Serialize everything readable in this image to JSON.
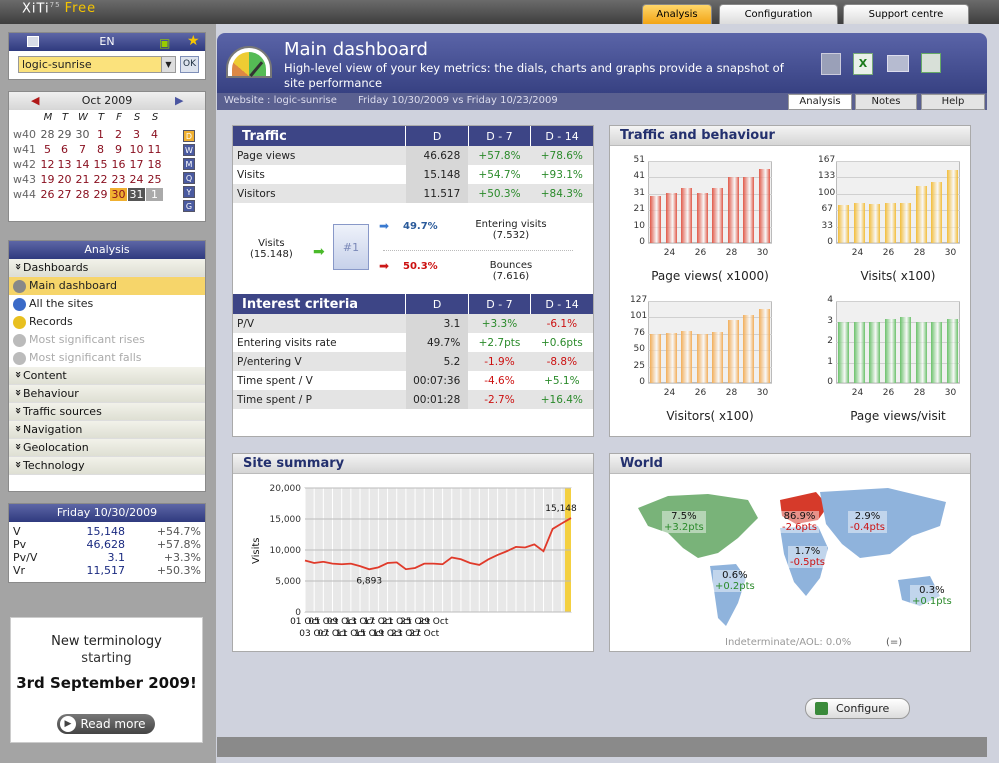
{
  "app": {
    "logo": "XiTi",
    "version": "75",
    "edition": "Free"
  },
  "top_tabs": [
    {
      "label": "Analysis",
      "active": true
    },
    {
      "label": "Configuration",
      "active": false
    },
    {
      "label": "Support centre",
      "active": false
    }
  ],
  "site": {
    "lang": "EN",
    "selected": "logic-sunrise",
    "ok": "OK"
  },
  "calendar": {
    "title": "Oct 2009",
    "weekdays": [
      "M",
      "T",
      "W",
      "T",
      "F",
      "S",
      "S"
    ],
    "weeks": [
      {
        "w": "w40",
        "days": [
          "28",
          "29",
          "30",
          "1",
          "2",
          "3",
          "4"
        ]
      },
      {
        "w": "w41",
        "days": [
          "5",
          "6",
          "7",
          "8",
          "9",
          "10",
          "11"
        ]
      },
      {
        "w": "w42",
        "days": [
          "12",
          "13",
          "14",
          "15",
          "16",
          "17",
          "18"
        ]
      },
      {
        "w": "w43",
        "days": [
          "19",
          "20",
          "21",
          "22",
          "23",
          "24",
          "25"
        ]
      },
      {
        "w": "w44",
        "days": [
          "26",
          "27",
          "28",
          "29",
          "30",
          "31",
          "1"
        ]
      }
    ],
    "period_buttons": [
      "D",
      "W",
      "M",
      "Q",
      "Y",
      "G"
    ]
  },
  "analysis_nav": {
    "title": "Analysis",
    "items": [
      {
        "label": "Dashboards",
        "type": "section"
      },
      {
        "label": "Main dashboard",
        "type": "active"
      },
      {
        "label": "All the sites",
        "type": "sub"
      },
      {
        "label": "Records",
        "type": "sub"
      },
      {
        "label": "Most significant rises",
        "type": "disabled"
      },
      {
        "label": "Most significant falls",
        "type": "disabled"
      },
      {
        "label": "Content",
        "type": "section"
      },
      {
        "label": "Behaviour",
        "type": "section"
      },
      {
        "label": "Traffic sources",
        "type": "section"
      },
      {
        "label": "Navigation",
        "type": "section"
      },
      {
        "label": "Geolocation",
        "type": "section"
      },
      {
        "label": "Technology",
        "type": "section"
      }
    ]
  },
  "day_summary": {
    "title": "Friday 10/30/2009",
    "rows": [
      {
        "k": "V",
        "v": "15,148",
        "d": "+54.7%"
      },
      {
        "k": "Pv",
        "v": "46,628",
        "d": "+57.8%"
      },
      {
        "k": "Pv/V",
        "v": "3.1",
        "d": "+3.3%"
      },
      {
        "k": "Vr",
        "v": "11,517",
        "d": "+50.3%"
      }
    ]
  },
  "promo": {
    "line1": "New terminology",
    "line2": "starting",
    "line3": "3rd September 2009!",
    "button": "Read more"
  },
  "header": {
    "title": "Main dashboard",
    "subtitle": "High-level view of your key metrics: the dials, charts and graphs provide a snapshot of site performance",
    "website": "Website : logic-sunrise",
    "period": "Friday 10/30/2009 vs Friday 10/23/2009",
    "tabs": [
      "Analysis",
      "Notes",
      "Help"
    ]
  },
  "traffic": {
    "title": "Traffic",
    "cols": [
      "D",
      "D - 7",
      "D - 14"
    ],
    "rows": [
      {
        "k": "Page views",
        "d": "46.628",
        "d7": "+57.8%",
        "d14": "+78.6%"
      },
      {
        "k": "Visits",
        "d": "15.148",
        "d7": "+54.7%",
        "d14": "+93.1%"
      },
      {
        "k": "Visitors",
        "d": "11.517",
        "d7": "+50.3%",
        "d14": "+84.3%"
      }
    ],
    "flow": {
      "visits_label": "Visits",
      "visits_value": "(15.148)",
      "page": "#1",
      "entering_pct": "49.7%",
      "entering_label": "Entering visits",
      "entering_value": "(7.532)",
      "bounce_pct": "50.3%",
      "bounce_label": "Bounces",
      "bounce_value": "(7.616)"
    }
  },
  "interest": {
    "title": "Interest criteria",
    "cols": [
      "D",
      "D - 7",
      "D - 14"
    ],
    "rows": [
      {
        "k": "P/V",
        "d": "3.1",
        "d7": "+3.3%",
        "d14": "-6.1%",
        "c7": "green",
        "c14": "red"
      },
      {
        "k": "Entering visits rate",
        "d": "49.7%",
        "d7": "+2.7pts",
        "d14": "+0.6pts",
        "c7": "green",
        "c14": "green"
      },
      {
        "k": "P/entering V",
        "d": "5.2",
        "d7": "-1.9%",
        "d14": "-8.8%",
        "c7": "red",
        "c14": "red"
      },
      {
        "k": "Time spent / V",
        "d": "00:07:36",
        "d7": "-4.6%",
        "d14": "+5.1%",
        "c7": "red",
        "c14": "green"
      },
      {
        "k": "Time spent / P",
        "d": "00:01:28",
        "d7": "-2.7%",
        "d14": "+16.4%",
        "c7": "red",
        "c14": "green"
      }
    ]
  },
  "behaviour_title": "Traffic and behaviour",
  "summary_title": "Site summary",
  "world": {
    "title": "World",
    "labels": [
      {
        "pct": "7.5%",
        "pts": "+3.2pts",
        "c": "green"
      },
      {
        "pct": "86.9%",
        "pts": "-2.6pts",
        "c": "red"
      },
      {
        "pct": "2.9%",
        "pts": "-0.4pts",
        "c": "red"
      },
      {
        "pct": "1.7%",
        "pts": "-0.5pts",
        "c": "red"
      },
      {
        "pct": "0.6%",
        "pts": "+0.2pts",
        "c": "green"
      },
      {
        "pct": "0.3%",
        "pts": "+0.1pts",
        "c": "green"
      }
    ],
    "footer": "Indeterminate/AOL: 0.0%",
    "footer2": "(=)"
  },
  "configure": "Configure",
  "chart_data": [
    {
      "type": "bar",
      "title": "Page views( x1000)",
      "color": "#e05a4a",
      "ylim": [
        0,
        51
      ],
      "yticks": [
        "51",
        "41",
        "31",
        "21",
        "10",
        "0"
      ],
      "x": [
        "24",
        "26",
        "28",
        "30"
      ],
      "values": [
        29,
        31,
        34,
        31,
        34,
        41,
        41,
        46
      ]
    },
    {
      "type": "bar",
      "title": "Visits( x100)",
      "color": "#f2bd3b",
      "ylim": [
        0,
        167
      ],
      "yticks": [
        "167",
        "133",
        "100",
        "67",
        "33",
        "0"
      ],
      "x": [
        "24",
        "26",
        "28",
        "30"
      ],
      "values": [
        78,
        81,
        80,
        81,
        81,
        117,
        124,
        148
      ]
    },
    {
      "type": "bar",
      "title": "Visitors( x100)",
      "color": "#f2ae5a",
      "ylim": [
        0,
        127
      ],
      "yticks": [
        "127",
        "101",
        "76",
        "50",
        "25",
        "0"
      ],
      "x": [
        "24",
        "26",
        "28",
        "30"
      ],
      "values": [
        76,
        78,
        80,
        76,
        79,
        98,
        106,
        115
      ]
    },
    {
      "type": "bar",
      "title": "Page views/visit",
      "color": "#6cc26c",
      "ylim": [
        0,
        4
      ],
      "yticks": [
        "4",
        "3",
        "2",
        "1",
        "0"
      ],
      "x": [
        "24",
        "26",
        "28",
        "30"
      ],
      "values": [
        3.0,
        3.0,
        3.0,
        3.1,
        3.2,
        3.0,
        3.0,
        3.1
      ]
    },
    {
      "type": "line",
      "title": "Site summary",
      "ylabel": "Visits",
      "ylim": [
        0,
        20000
      ],
      "yticks": [
        "20,000",
        "15,000",
        "10,000",
        "5,000",
        "0"
      ],
      "xticks_top": [
        "01 Oct",
        "05 Oct",
        "09 Oct",
        "13 Oct",
        "17 Oct",
        "21 Oct",
        "25 Oct",
        "29 Oct"
      ],
      "xticks_bottom": [
        "03 Oct",
        "07 Oct",
        "11 Oct",
        "15 Oct",
        "19 Oct",
        "23 Oct",
        "27 Oct"
      ],
      "values": [
        8300,
        7900,
        8100,
        7800,
        7700,
        7800,
        7400,
        6893,
        7200,
        7900,
        8000,
        6900,
        7100,
        7800,
        7800,
        7700,
        8800,
        8500,
        7900,
        7600,
        8500,
        9200,
        9800,
        10500,
        10400,
        10900,
        9800,
        13400,
        14300,
        15148
      ],
      "annotations": [
        {
          "label": "6,893",
          "index": 7
        },
        {
          "label": "15,148",
          "index": 29
        }
      ]
    }
  ]
}
